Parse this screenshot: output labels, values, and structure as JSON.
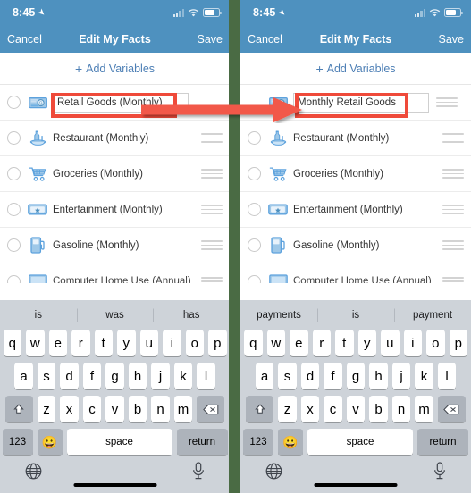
{
  "meta": {
    "description": "Two side-by-side iPhone screenshots showing a variable being renamed in an Edit My Facts list",
    "divider_color": "#4a6b44",
    "accent_blue": "#4e91bf",
    "link_blue": "#4d7fb5",
    "highlight_red": "#ef4a3a"
  },
  "status_bar": {
    "time": "8:45",
    "location_icon": "location-arrow-icon",
    "cellular_icon": "cellular-signal-icon",
    "wifi_icon": "wifi-icon",
    "battery_icon": "battery-icon"
  },
  "nav": {
    "cancel_label": "Cancel",
    "title": "Edit My Facts",
    "save_label": "Save"
  },
  "add_row": {
    "plus": "+",
    "label": "Add Variables"
  },
  "left_panel": {
    "edit_row": {
      "icon": "cash-money-icon",
      "value": "Retail Goods (Monthly)",
      "caret_visible": true,
      "highlighted": true
    },
    "rows": [
      {
        "icon": "restaurant-icon",
        "label": "Restaurant (Monthly)",
        "handle": "reorder-handle-icon",
        "radio": "radio-unchecked-icon"
      },
      {
        "icon": "shopping-cart-icon",
        "label": "Groceries (Monthly)",
        "handle": "reorder-handle-icon",
        "radio": "radio-unchecked-icon"
      },
      {
        "icon": "ticket-icon",
        "label": "Entertainment (Monthly)",
        "handle": "reorder-handle-icon",
        "radio": "radio-unchecked-icon"
      },
      {
        "icon": "gas-pump-icon",
        "label": "Gasoline (Monthly)",
        "handle": "reorder-handle-icon",
        "radio": "radio-unchecked-icon"
      },
      {
        "icon": "computer-icon",
        "label": "Computer Home Use (Annual)",
        "handle": "reorder-handle-icon",
        "radio": "radio-unchecked-icon",
        "clipped": true
      }
    ],
    "keyboard": {
      "suggestions": [
        "is",
        "was",
        "has"
      ],
      "row1": [
        "q",
        "w",
        "e",
        "r",
        "t",
        "y",
        "u",
        "i",
        "o",
        "p"
      ],
      "row2": [
        "a",
        "s",
        "d",
        "f",
        "g",
        "h",
        "j",
        "k",
        "l"
      ],
      "row3": [
        "z",
        "x",
        "c",
        "v",
        "b",
        "n",
        "m"
      ],
      "shift_icon": "shift-up-arrow-icon",
      "backspace_icon": "backspace-delete-icon",
      "numbers_label": "123",
      "emoji_icon": "emoji-smiley-icon",
      "space_label": "space",
      "return_label": "return",
      "globe_icon": "globe-language-icon",
      "mic_icon": "microphone-icon",
      "home_indicator": "home-indicator-bar"
    }
  },
  "right_panel": {
    "edit_row": {
      "icon": "cash-money-icon",
      "value": "Monthly Retail Goods",
      "caret_visible": false,
      "highlighted": true,
      "handle": "reorder-handle-icon"
    },
    "rows": [
      {
        "icon": "restaurant-icon",
        "label": "Restaurant (Monthly)",
        "handle": "reorder-handle-icon",
        "radio": "radio-unchecked-icon"
      },
      {
        "icon": "shopping-cart-icon",
        "label": "Groceries (Monthly)",
        "handle": "reorder-handle-icon",
        "radio": "radio-unchecked-icon"
      },
      {
        "icon": "ticket-icon",
        "label": "Entertainment (Monthly)",
        "handle": "reorder-handle-icon",
        "radio": "radio-unchecked-icon"
      },
      {
        "icon": "gas-pump-icon",
        "label": "Gasoline (Monthly)",
        "handle": "reorder-handle-icon",
        "radio": "radio-unchecked-icon"
      },
      {
        "icon": "computer-icon",
        "label": "Computer Home Use (Annual)",
        "handle": "reorder-handle-icon",
        "radio": "radio-unchecked-icon",
        "clipped": true
      }
    ],
    "keyboard": {
      "suggestions": [
        "payments",
        "is",
        "payment"
      ],
      "row1": [
        "q",
        "w",
        "e",
        "r",
        "t",
        "y",
        "u",
        "i",
        "o",
        "p"
      ],
      "row2": [
        "a",
        "s",
        "d",
        "f",
        "g",
        "h",
        "j",
        "k",
        "l"
      ],
      "row3": [
        "z",
        "x",
        "c",
        "v",
        "b",
        "n",
        "m"
      ],
      "shift_icon": "shift-up-arrow-icon",
      "backspace_icon": "backspace-delete-icon",
      "numbers_label": "123",
      "emoji_icon": "emoji-smiley-icon",
      "space_label": "space",
      "return_label": "return",
      "globe_icon": "globe-language-icon",
      "mic_icon": "microphone-icon",
      "home_indicator": "home-indicator-bar"
    }
  },
  "annotation": {
    "arrow_icon": "red-right-arrow-annotation"
  }
}
